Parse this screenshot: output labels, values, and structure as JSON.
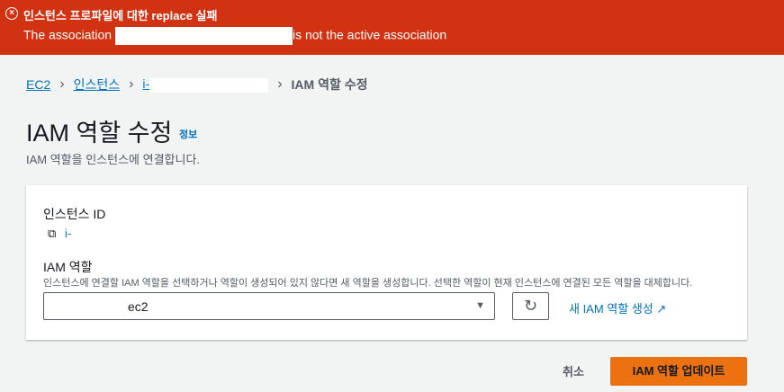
{
  "flash": {
    "title": "인스턴스 프로파일에 대한 replace 실패",
    "message_prefix": "The association",
    "message_suffix": "is not the active association",
    "icon": "error-circle-icon"
  },
  "breadcrumb": {
    "items": [
      "EC2",
      "인스턴스",
      "i-"
    ],
    "current": "IAM 역할 수정"
  },
  "page": {
    "title": "IAM 역할 수정",
    "info": "정보",
    "subtitle": "IAM 역할을 인스턴스에 연결합니다."
  },
  "form": {
    "instance_id_label": "인스턴스 ID",
    "instance_id_value": "i-",
    "iam_role_label": "IAM 역할",
    "iam_role_desc": "인스턴스에 연결할 IAM 역할을 선택하거나 역할이 생성되어 있지 않다면 새 역할을 생성합니다. 선택한 역할이 현재 인스턴스에 연결된 모든 역할을 대체합니다.",
    "iam_role_value": "ec2",
    "create_role": "새 IAM 역할 생성"
  },
  "actions": {
    "cancel": "취소",
    "update": "IAM 역할 업데이트"
  }
}
